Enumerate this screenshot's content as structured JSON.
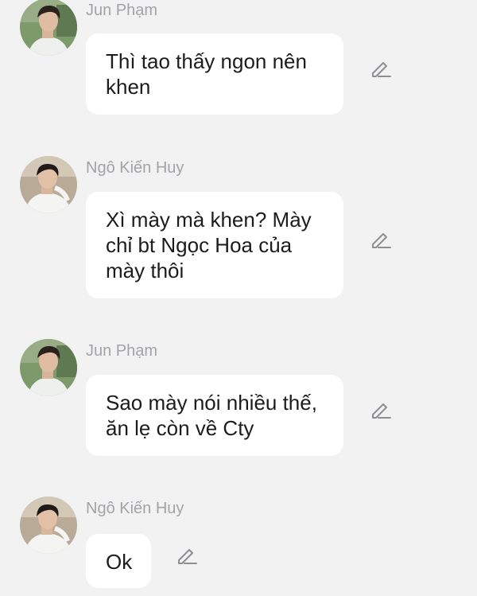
{
  "messages": [
    {
      "sender": "Jun Phạm",
      "text": "Thì tao thấy ngon nên khen",
      "avatar": "jun-avatar",
      "action_icon": "pencil-edit-icon"
    },
    {
      "sender": "Ngô Kiến Huy",
      "text": "Xì mày mà khen? Mày chỉ bt Ngọc Hoa của mày thôi",
      "avatar": "huy-avatar",
      "action_icon": "pencil-edit-icon"
    },
    {
      "sender": "Jun Phạm",
      "text": "Sao mày nói nhiều thế, ăn lẹ còn về Cty",
      "avatar": "jun-avatar",
      "action_icon": "pencil-edit-icon"
    },
    {
      "sender": "Ngô Kiến Huy",
      "text": "Ok",
      "avatar": "huy-avatar",
      "action_icon": "pencil-edit-icon"
    }
  ],
  "colors": {
    "background": "#f2f2f3",
    "bubble": "#ffffff",
    "sender_text": "#a3a3a8",
    "message_text": "#1c1c1e",
    "icon": "#8e8e93"
  }
}
